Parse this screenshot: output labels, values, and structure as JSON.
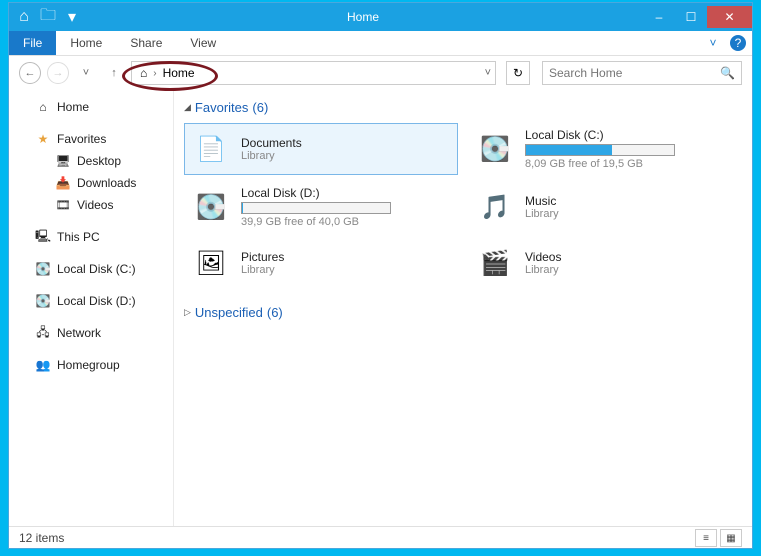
{
  "window": {
    "title": "Home"
  },
  "qat": {
    "dropdown": "▾"
  },
  "wbuttons": {
    "min": "–",
    "max": "☐",
    "close": "✕"
  },
  "ribbon": {
    "file": "File",
    "tabs": [
      "Home",
      "Share",
      "View"
    ],
    "chevron": "˅",
    "help": "?"
  },
  "nav": {
    "back": "←",
    "fwd": "→",
    "down": "˅",
    "up": "↑",
    "home_icon": "⌂",
    "sep": "›",
    "crumb": "Home",
    "addr_drop": "˅",
    "refresh": "↻"
  },
  "search": {
    "placeholder": "Search Home",
    "icon": "🔍"
  },
  "tree": {
    "home": "Home",
    "favorites": "Favorites",
    "desktop": "Desktop",
    "downloads": "Downloads",
    "videos": "Videos",
    "thispc": "This PC",
    "diskC": "Local Disk (C:)",
    "diskD": "Local Disk (D:)",
    "network": "Network",
    "homegroup": "Homegroup"
  },
  "groups": {
    "favorites": {
      "label": "Favorites",
      "count": "(6)",
      "arrow": "◢"
    },
    "unspecified": {
      "label": "Unspecified",
      "count": "(6)",
      "arrow": "▷"
    }
  },
  "items": {
    "documents": {
      "name": "Documents",
      "sub": "Library"
    },
    "diskC": {
      "name": "Local Disk (C:)",
      "free": "8,09 GB free of 19,5 GB",
      "fill_pct": 58
    },
    "diskD": {
      "name": "Local Disk (D:)",
      "free": "39,9 GB free of 40,0 GB",
      "fill_pct": 1
    },
    "music": {
      "name": "Music",
      "sub": "Library"
    },
    "pictures": {
      "name": "Pictures",
      "sub": "Library"
    },
    "videos": {
      "name": "Videos",
      "sub": "Library"
    }
  },
  "status": {
    "count": "12 items"
  },
  "colors": {
    "accent": "#1ba1e2",
    "file": "#1979ca"
  }
}
